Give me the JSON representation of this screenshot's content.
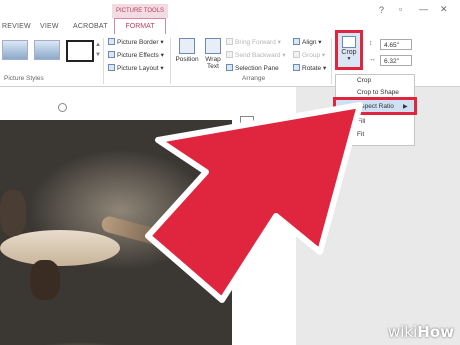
{
  "window": {
    "help_label": "?",
    "restore_label": "▫",
    "minimize_label": "—",
    "close_label": "✕"
  },
  "tabs": {
    "context_group": "PICTURE TOOLS",
    "items": [
      {
        "label": "REVIEW"
      },
      {
        "label": "VIEW"
      },
      {
        "label": "ACROBAT"
      },
      {
        "label": "FORMAT"
      }
    ]
  },
  "ribbon": {
    "picture_styles": {
      "label": "Picture Styles",
      "commands": [
        "Picture Border",
        "Picture Effects",
        "Picture Layout"
      ]
    },
    "arrange": {
      "label": "Arrange",
      "position_label": "Position",
      "wrap_text_label": "Wrap Text",
      "commands": [
        {
          "label": "Bring Forward",
          "enabled": false
        },
        {
          "label": "Send Backward",
          "enabled": false
        },
        {
          "label": "Selection Pane",
          "enabled": true
        }
      ],
      "align_commands": [
        {
          "label": "Align",
          "enabled": true
        },
        {
          "label": "Group",
          "enabled": false
        },
        {
          "label": "Rotate",
          "enabled": true
        }
      ]
    },
    "size": {
      "crop_label": "Crop",
      "height": "4.65\"",
      "width": "6.32\""
    }
  },
  "crop_menu": {
    "items": [
      "Crop",
      "Crop to Shape",
      "Aspect Ratio",
      "Fill",
      "Fit"
    ],
    "highlighted": "Aspect Ratio"
  },
  "watermark": {
    "brand_wiki": "wiki",
    "brand_how": "How"
  },
  "colors": {
    "accent_red": "#e0253f",
    "format_tab": "#b8405e",
    "highlight_blue": "#cfe0f2"
  }
}
